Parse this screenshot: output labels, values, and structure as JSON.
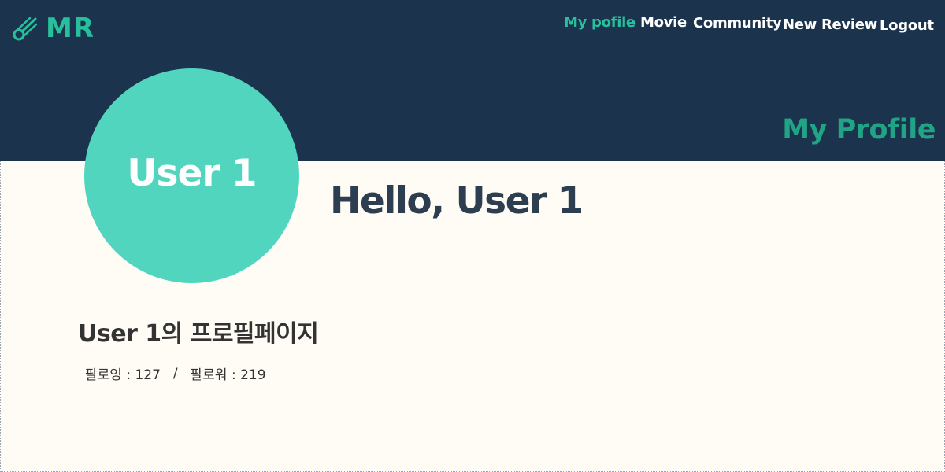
{
  "brand": {
    "logo_icon": "comet-icon",
    "text": "MR",
    "color": "#28bf9c"
  },
  "nav": {
    "items": [
      {
        "label": "My pofile",
        "active": true
      },
      {
        "label": "Movie",
        "active": false
      },
      {
        "label": "Community",
        "active": false
      },
      {
        "label": "New Review",
        "active": false
      },
      {
        "label": "Logout",
        "active": false
      }
    ]
  },
  "header": {
    "page_heading": "My Profile",
    "background": "#1b334d"
  },
  "profile": {
    "avatar_text": "User 1",
    "avatar_color": "#52d5be",
    "greeting": "Hello, User 1",
    "title": "User 1의 프로필페이지",
    "following": "팔로잉 : 127",
    "separator": "/",
    "followers": "팔로워 : 219"
  },
  "colors": {
    "accent": "#28bf9c",
    "page_background": "#fffbf5",
    "text_dark": "#2c3e50"
  }
}
